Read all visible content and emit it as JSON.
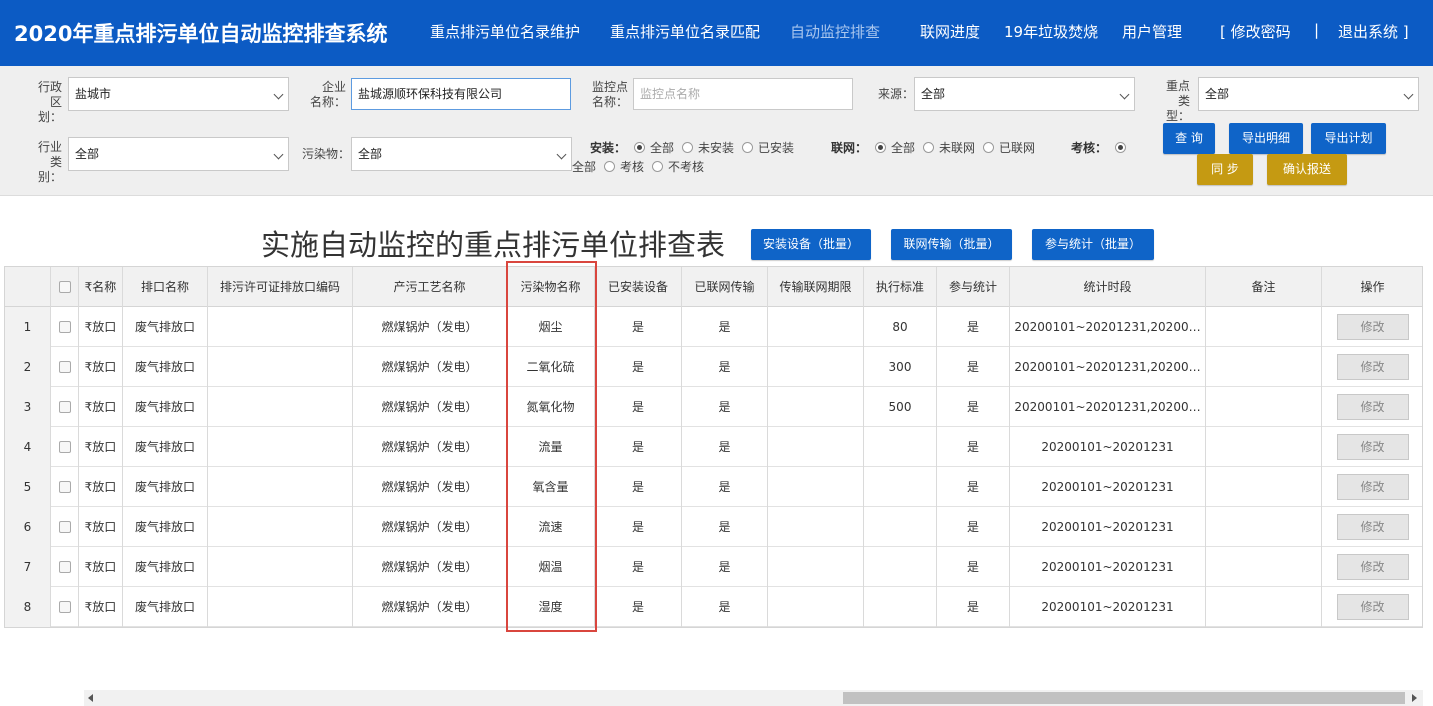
{
  "app_title": "2020年重点排污单位自动监控排查系统",
  "nav": [
    "重点排污单位名录维护",
    "重点排污单位名录匹配",
    "自动监控排查",
    "联网进度",
    "19年垃圾焚烧",
    "用户管理",
    "[ 修改密码",
    "|",
    "退出系统 ]"
  ],
  "filters": {
    "region_label_1": "行政",
    "region_label_2": "区划：",
    "region_value": "盐城市",
    "company_label_1": "企业",
    "company_label_2": "名称：",
    "company_value": "盐城源顺环保科技有限公司",
    "monitor_label_1": "监控点",
    "monitor_label_2": "名称：",
    "monitor_placeholder": "监控点名称",
    "source_label": "来源：",
    "source_value": "全部",
    "keytype_label_1": "重点",
    "keytype_label_2": "类型：",
    "keytype_value": "全部",
    "industry_label_1": "行业",
    "industry_label_2": "类别：",
    "industry_value": "全部",
    "pollutant_label": "污染物：",
    "pollutant_value": "全部",
    "install_label": "安装：",
    "install_opts": [
      "全部",
      "未安装",
      "已安装"
    ],
    "network_label": "联网：",
    "network_opts": [
      "全部",
      "未联网",
      "已联网"
    ],
    "assess_label": "考核：",
    "assess_opts": [
      "全部",
      "考核",
      "不考核"
    ]
  },
  "buttons": {
    "query": "查 询",
    "export_detail": "导出明细",
    "export_plan": "导出计划",
    "sync": "同 步",
    "confirm_report": "确认报送"
  },
  "report_title": "实施自动监控的重点排污单位排查表",
  "batch_buttons": [
    "安装设备（批量）",
    "联网传输（批量）",
    "参与统计（批量）"
  ],
  "table": {
    "headers": [
      "",
      "",
      "₹名称",
      "排口名称",
      "排污许可证排放口编码",
      "产污工艺名称",
      "污染物名称",
      "已安装设备",
      "已联网传输",
      "传输联网期限",
      "执行标准",
      "参与统计",
      "统计时段",
      "备注",
      "操作"
    ],
    "rows": [
      [
        "1",
        "",
        "₹放口",
        "废气排放口",
        "",
        "燃煤锅炉（发电）",
        "烟尘",
        "是",
        "是",
        "",
        "80",
        "是",
        "20200101~20201231,20200…",
        "",
        "修改"
      ],
      [
        "2",
        "",
        "₹放口",
        "废气排放口",
        "",
        "燃煤锅炉（发电）",
        "二氧化硫",
        "是",
        "是",
        "",
        "300",
        "是",
        "20200101~20201231,20200…",
        "",
        "修改"
      ],
      [
        "3",
        "",
        "₹放口",
        "废气排放口",
        "",
        "燃煤锅炉（发电）",
        "氮氧化物",
        "是",
        "是",
        "",
        "500",
        "是",
        "20200101~20201231,20200…",
        "",
        "修改"
      ],
      [
        "4",
        "",
        "₹放口",
        "废气排放口",
        "",
        "燃煤锅炉（发电）",
        "流量",
        "是",
        "是",
        "",
        "",
        "是",
        "20200101~20201231",
        "",
        "修改"
      ],
      [
        "5",
        "",
        "₹放口",
        "废气排放口",
        "",
        "燃煤锅炉（发电）",
        "氧含量",
        "是",
        "是",
        "",
        "",
        "是",
        "20200101~20201231",
        "",
        "修改"
      ],
      [
        "6",
        "",
        "₹放口",
        "废气排放口",
        "",
        "燃煤锅炉（发电）",
        "流速",
        "是",
        "是",
        "",
        "",
        "是",
        "20200101~20201231",
        "",
        "修改"
      ],
      [
        "7",
        "",
        "₹放口",
        "废气排放口",
        "",
        "燃煤锅炉（发电）",
        "烟温",
        "是",
        "是",
        "",
        "",
        "是",
        "20200101~20201231",
        "",
        "修改"
      ],
      [
        "8",
        "",
        "₹放口",
        "废气排放口",
        "",
        "燃煤锅炉（发电）",
        "湿度",
        "是",
        "是",
        "",
        "",
        "是",
        "20200101~20201231",
        "",
        "修改"
      ]
    ]
  }
}
